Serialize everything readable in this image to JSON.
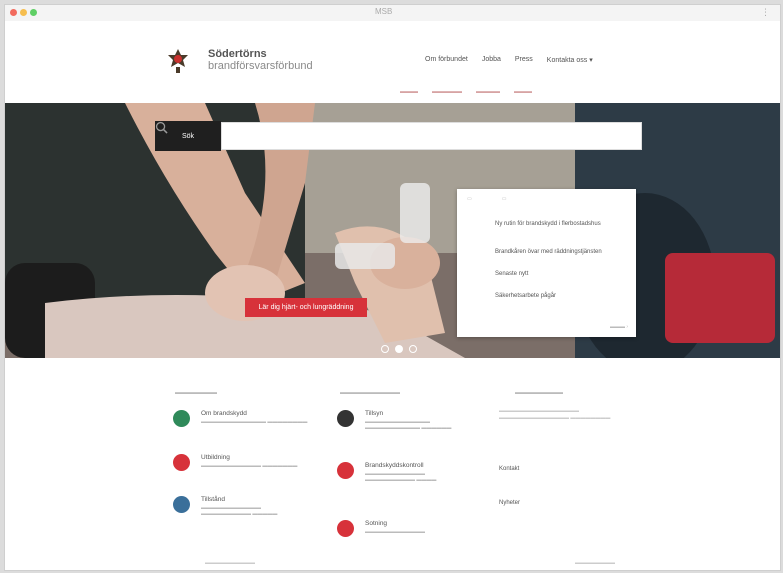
{
  "browser": {
    "tab_title": "MSB",
    "menu_label": "⋮"
  },
  "header": {
    "brand_bold": "Södertörns",
    "brand_line1_rest": "",
    "brand_line2": "brandförsvarsförbund",
    "nav": [
      "Om förbundet",
      "Jobba",
      "Press",
      "Kontakta oss"
    ],
    "nav_dropdown_icon": "chevron-down-icon"
  },
  "hero": {
    "search_label": "Sök",
    "search_placeholder": "",
    "cta_label": "Lär dig hjärt- och lungräddning",
    "slide_count": 3,
    "active_slide": 2,
    "news": [
      {
        "title": "Ny rutin för brandskydd i flerbostadshus",
        "date": ""
      },
      {
        "title": "Brandkåren övar med räddningstjänsten",
        "date": ""
      },
      {
        "title": "Senaste nytt",
        "date": ""
      },
      {
        "title": "Säkerhetsarbete pågår",
        "date": ""
      }
    ]
  },
  "content": {
    "items_left": [
      {
        "title": "Om brandskydd",
        "icon": "flame-icon",
        "color": "#2f8a5a"
      },
      {
        "title": "Utbildning",
        "icon": "book-icon",
        "color": "#d7323a"
      },
      {
        "title": "Tillstånd",
        "icon": "document-icon",
        "color": "#3a6f9a"
      }
    ],
    "items_mid": [
      {
        "title": "Tillsyn",
        "icon": "shield-icon",
        "color": "#333333"
      },
      {
        "title": "Brandskyddskontroll",
        "icon": "building-icon",
        "color": "#d7323a"
      },
      {
        "title": "Sotning",
        "icon": "chimney-icon",
        "color": "#d7323a"
      }
    ],
    "sidebar": [
      {
        "title": "Kontakt",
        "sub": ""
      },
      {
        "title": "Nyheter",
        "sub": ""
      }
    ]
  }
}
